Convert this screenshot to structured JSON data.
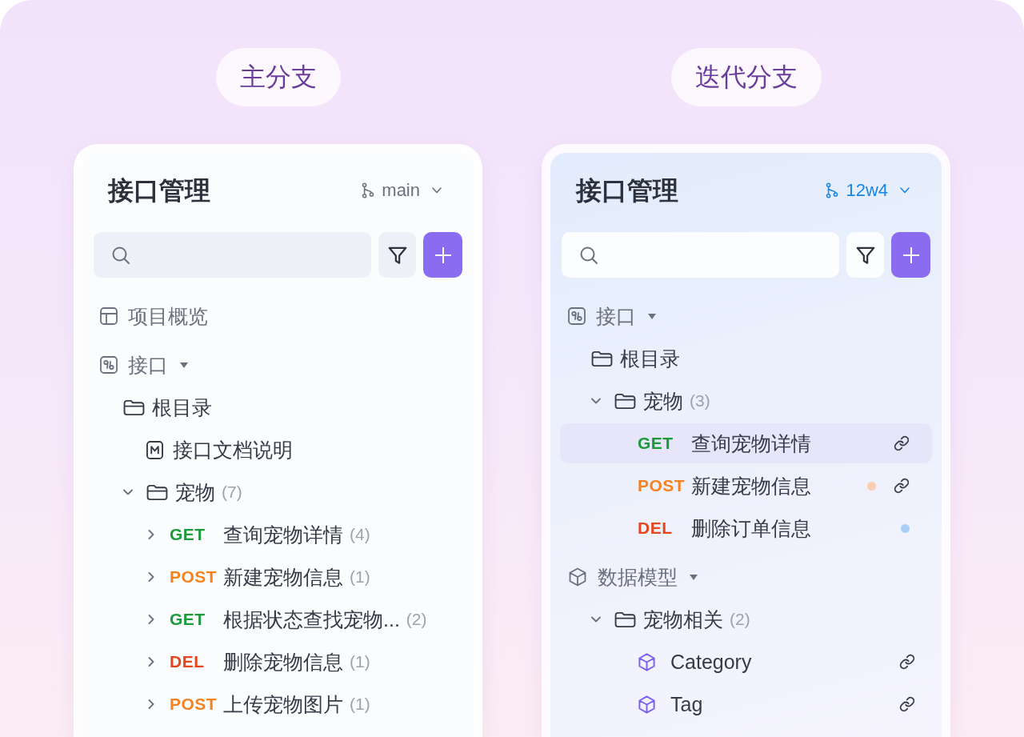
{
  "columns": [
    {
      "label": "主分支",
      "panel": {
        "highlighted": false,
        "title": "接口管理",
        "branch": {
          "name": "main"
        },
        "tree": [
          {
            "kind": "overview",
            "label": "项目概览",
            "selected": false
          },
          {
            "kind": "apis",
            "label": "接口",
            "selected": false,
            "children": [
              {
                "kind": "folder",
                "label": "根目录",
                "selected": false,
                "children": [
                  {
                    "kind": "doc",
                    "label": "接口文档说明",
                    "selected": false
                  }
                ]
              },
              {
                "kind": "folder",
                "label": "宠物",
                "count": "(7)",
                "expanded": true,
                "selected": false,
                "children": [
                  {
                    "kind": "endpoint",
                    "method": {
                      "label": "GET",
                      "color": "#1a9a3b"
                    },
                    "label": "查询宠物详情",
                    "count": "(4)",
                    "expanded": false,
                    "selected": false
                  },
                  {
                    "kind": "endpoint",
                    "method": {
                      "label": "POST",
                      "color": "#f5821f"
                    },
                    "label": "新建宠物信息",
                    "count": "(1)",
                    "expanded": false,
                    "selected": false
                  },
                  {
                    "kind": "endpoint",
                    "method": {
                      "label": "GET",
                      "color": "#1a9a3b"
                    },
                    "label": "根据状态查找宠物...",
                    "count": "(2)",
                    "expanded": false,
                    "selected": false
                  },
                  {
                    "kind": "endpoint",
                    "method": {
                      "label": "DEL",
                      "color": "#e5461c"
                    },
                    "label": "删除宠物信息",
                    "count": "(1)",
                    "expanded": false,
                    "selected": false
                  },
                  {
                    "kind": "endpoint",
                    "method": {
                      "label": "POST",
                      "color": "#f5821f"
                    },
                    "label": "上传宠物图片",
                    "count": "(1)",
                    "expanded": false,
                    "selected": false
                  }
                ]
              }
            ]
          }
        ]
      }
    },
    {
      "label": "迭代分支",
      "panel": {
        "highlighted": true,
        "title": "接口管理",
        "branch": {
          "name": "12w4"
        },
        "tree": [
          {
            "kind": "apis",
            "label": "接口",
            "selected": false,
            "children": [
              {
                "kind": "folder",
                "label": "根目录",
                "selected": false
              },
              {
                "kind": "folder",
                "label": "宠物",
                "count": "(3)",
                "expanded": true,
                "selected": false,
                "children": [
                  {
                    "kind": "endpoint",
                    "method": {
                      "label": "GET",
                      "color": "#1a9a3b"
                    },
                    "label": "查询宠物详情",
                    "selected": true,
                    "linked": true
                  },
                  {
                    "kind": "endpoint",
                    "method": {
                      "label": "POST",
                      "color": "#f5821f"
                    },
                    "label": "新建宠物信息",
                    "selected": false,
                    "linked": true,
                    "status": {
                      "color": "#fbcdb1"
                    }
                  },
                  {
                    "kind": "endpoint",
                    "method": {
                      "label": "DEL",
                      "color": "#e5461c"
                    },
                    "label": "删除订单信息",
                    "selected": false,
                    "linked": false,
                    "status": {
                      "color": "#a8d0f6"
                    }
                  }
                ]
              }
            ]
          },
          {
            "kind": "models",
            "label": "数据模型",
            "selected": false,
            "children": [
              {
                "kind": "folder",
                "label": "宠物相关",
                "count": "(2)",
                "expanded": true,
                "selected": false,
                "children": [
                  {
                    "kind": "model",
                    "label": "Category",
                    "selected": false,
                    "linked": true
                  },
                  {
                    "kind": "model",
                    "label": "Tag",
                    "selected": false,
                    "linked": true
                  }
                ]
              }
            ]
          }
        ]
      }
    }
  ]
}
